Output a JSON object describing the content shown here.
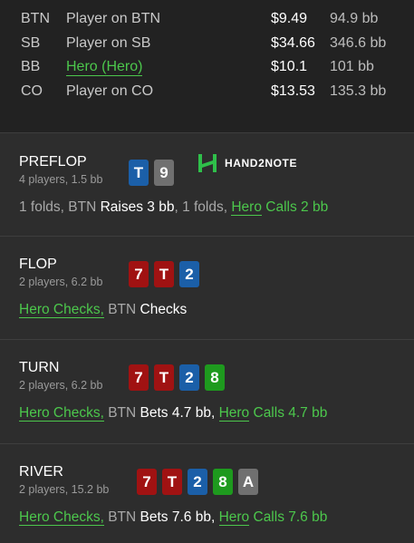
{
  "players": [
    {
      "pos": "BTN",
      "name": "Player on BTN",
      "stack": "$9.49",
      "bb": "94.9 bb"
    },
    {
      "pos": "SB",
      "name": "Player on SB",
      "stack": "$34.66",
      "bb": "346.6 bb"
    },
    {
      "pos": "BB",
      "name": "Hero (Hero)",
      "stack": "$10.1",
      "bb": "101 bb"
    },
    {
      "pos": "CO",
      "name": "Player on CO",
      "stack": "$13.53",
      "bb": "135.3 bb"
    }
  ],
  "logo": {
    "text": "HAND2NOTE"
  },
  "streets": {
    "preflop": {
      "name": "PREFLOP",
      "meta": "4 players, 1.5 bb",
      "cards": [
        "T",
        "9"
      ],
      "action": {
        "p1": "1 folds, BTN ",
        "b1": "Raises 3 bb",
        "p2": ", 1 folds, ",
        "hero": "Hero",
        "h2": " Calls 2 bb"
      }
    },
    "flop": {
      "name": "FLOP",
      "meta": "2 players, 6.2 bb",
      "cards": [
        "7",
        "T",
        "2"
      ],
      "action": {
        "hero": "Hero Checks,",
        "p1": " BTN ",
        "b1": "Checks"
      }
    },
    "turn": {
      "name": "TURN",
      "meta": "2 players, 6.2 bb",
      "cards": [
        "7",
        "T",
        "2",
        "8"
      ],
      "action": {
        "hero": "Hero Checks,",
        "p1": " BTN ",
        "b1": "Bets 4.7 bb,",
        "p2": " ",
        "hero2": "Hero",
        "h2": " Calls 4.7 bb"
      }
    },
    "river": {
      "name": "RIVER",
      "meta": "2 players, 15.2 bb",
      "cards": [
        "7",
        "T",
        "2",
        "8",
        "A"
      ],
      "action": {
        "hero": "Hero Checks,",
        "p1": " BTN ",
        "b1": "Bets 7.6 bb,",
        "p2": " ",
        "hero2": "Hero",
        "h2": " Calls 7.6 bb"
      }
    }
  },
  "colors": {
    "hero": "#4cc74c",
    "card_red": "#a01212",
    "card_blue": "#1b5fa8",
    "card_green": "#1e9a1e",
    "card_gray": "#707070"
  }
}
